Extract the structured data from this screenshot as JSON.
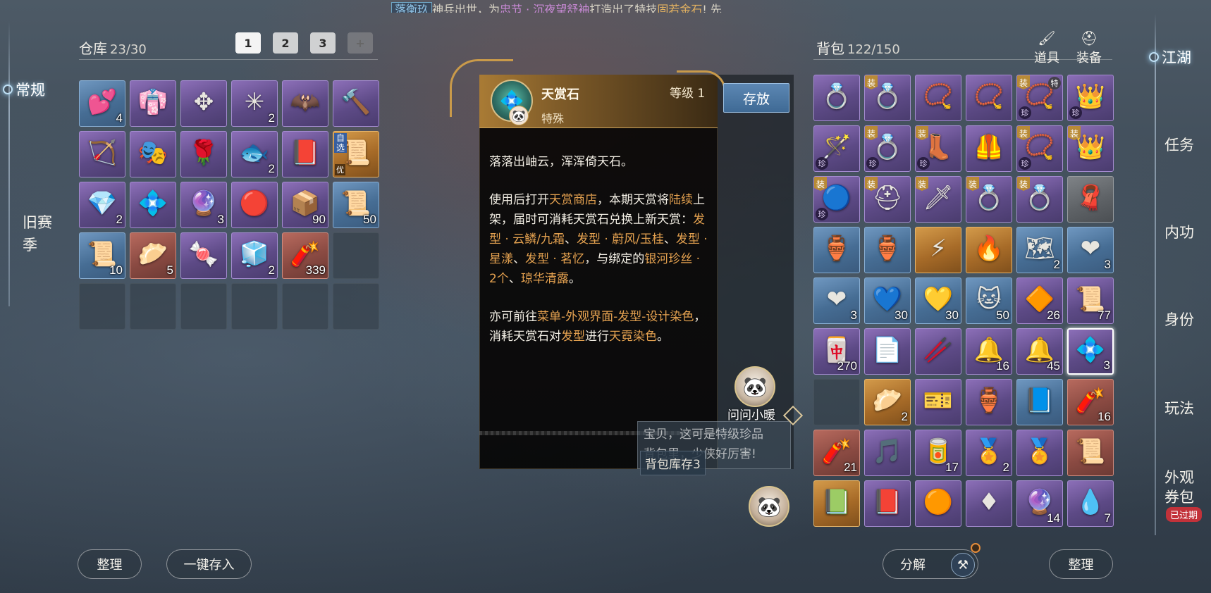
{
  "ticker": {
    "tag": "落衡玖",
    "text1": "神兵出世，为",
    "name": "忠节 · 沉夜望舒袖",
    "text2": "打造出了特技",
    "skill": "固若金石",
    "text3": "! 先"
  },
  "left_nav": {
    "active": "常规",
    "old_season": "旧赛季"
  },
  "warehouse": {
    "title": "仓库",
    "count": "23/30",
    "tabs": [
      "1",
      "2",
      "3",
      "+"
    ],
    "items": [
      {
        "q": "blue",
        "icon": "heart-icon",
        "glyph": "💕",
        "qty": "4"
      },
      {
        "q": "purple",
        "icon": "robe-icon",
        "glyph": "👘",
        "qty": ""
      },
      {
        "q": "purple",
        "icon": "emblem-icon",
        "glyph": "✥",
        "qty": ""
      },
      {
        "q": "purple",
        "icon": "hairpin-icon",
        "glyph": "✳",
        "qty": "2"
      },
      {
        "q": "purple",
        "icon": "mask-icon",
        "glyph": "🦇",
        "qty": ""
      },
      {
        "q": "purple",
        "icon": "hammer-icon",
        "glyph": "🔨",
        "qty": ""
      },
      {
        "q": "purple",
        "icon": "bow-icon",
        "glyph": "🏹",
        "qty": ""
      },
      {
        "q": "purple",
        "icon": "mask-icon",
        "glyph": "🎭",
        "qty": ""
      },
      {
        "q": "purple",
        "icon": "flower-icon",
        "glyph": "🌹",
        "qty": ""
      },
      {
        "q": "purple",
        "icon": "fish-icon",
        "glyph": "🐟",
        "qty": "2"
      },
      {
        "q": "purple",
        "icon": "book-icon",
        "glyph": "📕",
        "qty": ""
      },
      {
        "q": "gold",
        "icon": "scroll-icon",
        "glyph": "📜",
        "qty": "",
        "zx": "自选",
        "you": "优"
      },
      {
        "q": "purple",
        "icon": "gem-icon",
        "glyph": "💎",
        "qty": "2"
      },
      {
        "q": "purple",
        "icon": "flower-icon",
        "glyph": "💠",
        "qty": ""
      },
      {
        "q": "purple",
        "icon": "orb-icon",
        "glyph": "🔮",
        "qty": "3"
      },
      {
        "q": "purple",
        "icon": "orb-icon",
        "glyph": "🔴",
        "qty": ""
      },
      {
        "q": "purple",
        "icon": "chest-icon",
        "glyph": "📦",
        "qty": "90"
      },
      {
        "q": "blue",
        "icon": "scroll-icon",
        "glyph": "📜",
        "qty": "50"
      },
      {
        "q": "blue",
        "icon": "scroll-icon",
        "glyph": "📜",
        "qty": "10"
      },
      {
        "q": "red",
        "icon": "dumpling-icon",
        "glyph": "🥟",
        "qty": "5"
      },
      {
        "q": "purple",
        "icon": "gift-icon",
        "glyph": "🍬",
        "qty": ""
      },
      {
        "q": "purple",
        "icon": "box-icon",
        "glyph": "🧊",
        "qty": "2"
      },
      {
        "q": "red",
        "icon": "firecracker-icon",
        "glyph": "🧨",
        "qty": "339"
      },
      {
        "q": "empty"
      },
      {
        "q": "empty"
      },
      {
        "q": "empty"
      },
      {
        "q": "empty"
      },
      {
        "q": "empty"
      },
      {
        "q": "empty"
      },
      {
        "q": "empty"
      }
    ]
  },
  "detail": {
    "name": "天赏石",
    "type": "特殊",
    "level": "等级 1",
    "store_button": "存放",
    "para1": "落落出岫云，浑浑倚天石。",
    "p2_a": "使用后打开",
    "p2_b": "天赏商店",
    "p2_c": "，本期天赏将",
    "p2_d": "陆续",
    "p2_e": "上架，届时可消耗天赏石兑换",
    "p2_f": "上新天赏：",
    "p2_g": "发型 · 云鳞/九霜",
    "p2_h": "、",
    "p2_i": "发型 · 蔚风/玉桂",
    "p2_j": "、",
    "p2_k": "发型 · 星漾",
    "p2_l": "、",
    "p2_m": "发型 · 茗忆",
    "p2_n": "，与绑定的",
    "p2_o": "银河珍丝 · 2个",
    "p2_p": "、",
    "p2_q": "琼华清露",
    "p2_r": "。",
    "p3_a": "亦可前往",
    "p3_b": "菜单-外观界面-发型-设计染色",
    "p3_c": "，消耗天赏石对",
    "p3_d": "发型",
    "p3_e": "进行",
    "p3_f": "天霓染色",
    "p3_g": "。",
    "stock": "背包库存3"
  },
  "helper": {
    "name": "问问小暖",
    "bubble_line1": "宝贝，这可是特级珍品",
    "bubble_line2": "背包里，少侠好厉害!"
  },
  "backpack": {
    "title": "背包",
    "count": "122/150",
    "tab_items": "道具",
    "tab_equip": "装备",
    "items": [
      {
        "q": "purple",
        "icon": "ring-icon",
        "glyph": "💍"
      },
      {
        "q": "purple",
        "icon": "ring-icon",
        "glyph": "💍",
        "zhuang": "装"
      },
      {
        "q": "purple",
        "icon": "necklace-icon",
        "glyph": "📿"
      },
      {
        "q": "purple",
        "icon": "necklace-icon",
        "glyph": "📿"
      },
      {
        "q": "purple",
        "icon": "necklace-icon",
        "glyph": "📿",
        "zhuang": "装",
        "te": "特",
        "zhen": "珍"
      },
      {
        "q": "purple",
        "icon": "crown-icon",
        "glyph": "👑",
        "zhen": "珍"
      },
      {
        "q": "purple",
        "icon": "scepter-icon",
        "glyph": "🪄",
        "zhen": "珍"
      },
      {
        "q": "purple",
        "icon": "ring-icon",
        "glyph": "💍",
        "zhuang": "装",
        "zhen": "珍"
      },
      {
        "q": "purple",
        "icon": "boots-icon",
        "glyph": "👢",
        "zhuang": "装",
        "zhen": "珍"
      },
      {
        "q": "purple",
        "icon": "armor-icon",
        "glyph": "🦺"
      },
      {
        "q": "purple",
        "icon": "necklace-icon",
        "glyph": "📿",
        "zhuang": "装",
        "zhen": "珍"
      },
      {
        "q": "purple",
        "icon": "crown-icon",
        "glyph": "👑",
        "zhuang": "装"
      },
      {
        "q": "purple",
        "icon": "orb-icon",
        "glyph": "🔵",
        "zhuang": "装",
        "zhen": "珍"
      },
      {
        "q": "purple",
        "icon": "helmet-icon",
        "glyph": "⛑",
        "zhuang": "装"
      },
      {
        "q": "purple",
        "icon": "blade-icon",
        "glyph": "🗡",
        "zhuang": "装"
      },
      {
        "q": "purple",
        "icon": "ring-icon",
        "glyph": "💍",
        "zhuang": "装"
      },
      {
        "q": "purple",
        "icon": "ring-icon",
        "glyph": "💍",
        "zhuang": "装"
      },
      {
        "q": "grey",
        "icon": "cloth-icon",
        "glyph": "🧣"
      },
      {
        "q": "blue",
        "icon": "jar-icon",
        "glyph": "🏺"
      },
      {
        "q": "blue",
        "icon": "jar-icon",
        "glyph": "🏺"
      },
      {
        "q": "gold",
        "icon": "claw-icon",
        "glyph": "⚡"
      },
      {
        "q": "gold",
        "icon": "flame-icon",
        "glyph": "🔥"
      },
      {
        "q": "blue",
        "icon": "map-icon",
        "glyph": "🗺",
        "qty": "2"
      },
      {
        "q": "blue",
        "icon": "heart-icon",
        "glyph": "❤",
        "qty": "3"
      },
      {
        "q": "blue",
        "icon": "heart-icon",
        "glyph": "❤",
        "qty": "3"
      },
      {
        "q": "blue",
        "icon": "heart-icon",
        "glyph": "💙",
        "qty": "30"
      },
      {
        "q": "blue",
        "icon": "heart-icon",
        "glyph": "💛",
        "qty": "30"
      },
      {
        "q": "blue",
        "icon": "cat-icon",
        "glyph": "🐱",
        "qty": "50"
      },
      {
        "q": "purple",
        "icon": "crystal-icon",
        "glyph": "🔶",
        "qty": "26"
      },
      {
        "q": "purple",
        "icon": "scroll-icon",
        "glyph": "📜",
        "qty": "77"
      },
      {
        "q": "purple",
        "icon": "seal-icon",
        "glyph": "🀄",
        "qty": "270"
      },
      {
        "q": "purple",
        "icon": "letter-icon",
        "glyph": "📄"
      },
      {
        "q": "purple",
        "icon": "spear-icon",
        "glyph": "🥢"
      },
      {
        "q": "purple",
        "icon": "bell-icon",
        "glyph": "🔔",
        "qty": "16"
      },
      {
        "q": "purple",
        "icon": "bell-icon",
        "glyph": "🔔",
        "qty": "45"
      },
      {
        "q": "purple",
        "icon": "sky-stone-icon",
        "glyph": "💠",
        "qty": "3",
        "selected": true
      },
      {
        "q": "empty"
      },
      {
        "q": "gold",
        "icon": "dumpling-icon",
        "glyph": "🥟",
        "qty": "2"
      },
      {
        "q": "purple",
        "icon": "ticket-icon",
        "glyph": "🎫"
      },
      {
        "q": "purple",
        "icon": "vase-icon",
        "glyph": "🏺"
      },
      {
        "q": "blue",
        "icon": "scroll-icon",
        "glyph": "📘"
      },
      {
        "q": "red",
        "icon": "firecracker-icon",
        "glyph": "🧨",
        "qty": "16"
      },
      {
        "q": "red",
        "icon": "firework-icon",
        "glyph": "🧨",
        "qty": "21"
      },
      {
        "q": "purple",
        "icon": "music-icon",
        "glyph": "🎵"
      },
      {
        "q": "purple",
        "icon": "rod-icon",
        "glyph": "🥫",
        "qty": "17"
      },
      {
        "q": "purple",
        "icon": "medal-icon",
        "glyph": "🏅",
        "qty": "2"
      },
      {
        "q": "purple",
        "icon": "medal-icon",
        "glyph": "🏅"
      },
      {
        "q": "red",
        "icon": "scroll-icon",
        "glyph": "📜"
      },
      {
        "q": "gold",
        "icon": "book-icon",
        "glyph": "📗"
      },
      {
        "q": "purple",
        "icon": "book-icon",
        "glyph": "📕"
      },
      {
        "q": "purple",
        "icon": "coin-icon",
        "glyph": "🟠"
      },
      {
        "q": "purple",
        "icon": "gem-icon",
        "glyph": "♦"
      },
      {
        "q": "purple",
        "icon": "orb-icon",
        "glyph": "🔮",
        "qty": "14"
      },
      {
        "q": "purple",
        "icon": "water-icon",
        "glyph": "💧",
        "qty": "7"
      }
    ]
  },
  "right_nav": {
    "active": "江湖",
    "items": [
      "任务",
      "内功",
      "身份",
      "玩法"
    ],
    "wardrobe_line1": "外观",
    "wardrobe_line2": "券包",
    "expired": "已过期"
  },
  "buttons": {
    "sort_left": "整理",
    "deposit_all": "一键存入",
    "decompose": "分解",
    "sort_right": "整理"
  },
  "colors": {
    "highlight": "#e5a250",
    "purple_quality": "#5d4a86",
    "blue_quality": "#466d94",
    "gold_quality": "#a76b28",
    "red_quality": "#8a4a42"
  }
}
